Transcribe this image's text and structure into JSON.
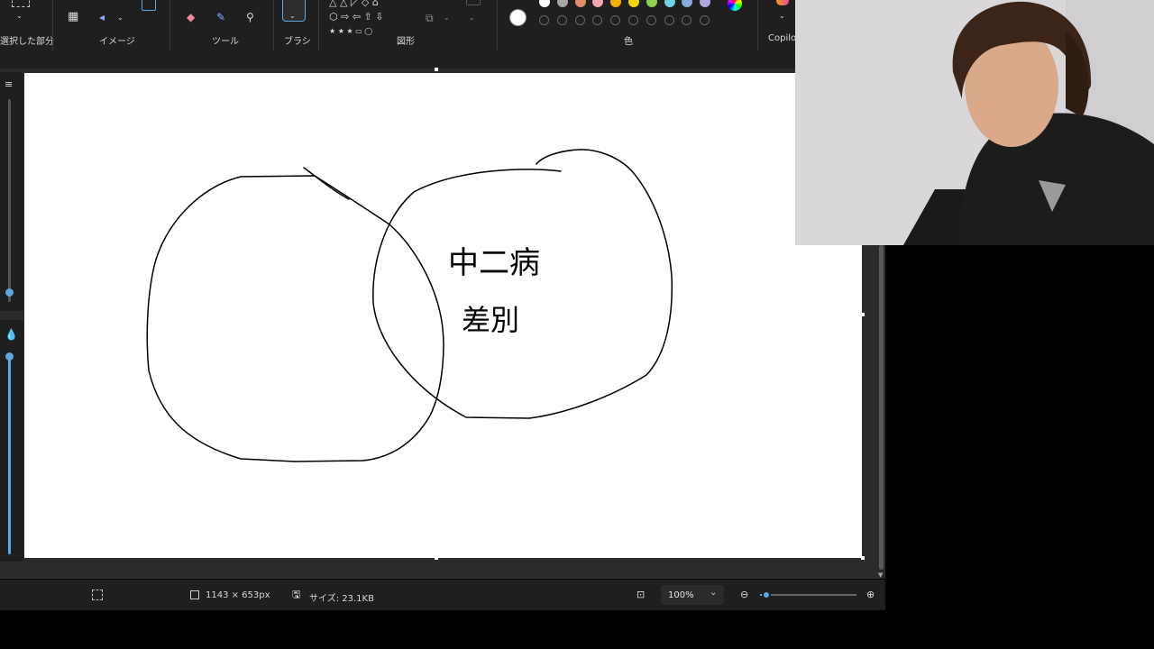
{
  "ribbon": {
    "selection_label": "選択した部分",
    "image_label": "イメージ",
    "tools_label": "ツール",
    "brushes_label": "ブラシ",
    "shapes_label": "図形",
    "colors_label": "色",
    "copilot_label": "Copilot"
  },
  "palette": {
    "row1": [
      "#ffffff",
      "#a6a6a6",
      "#e08c6a",
      "#f4a6b0",
      "#f5b200",
      "#f5d600",
      "#8fd14f",
      "#6fd4e6",
      "#8aa9e0",
      "#b4a7e0"
    ],
    "current_color": "#ffffff"
  },
  "canvas": {
    "handwriting_line1": "中二病",
    "handwriting_line2": "差別"
  },
  "status": {
    "dimensions": "1143 × 653px",
    "size": "サイズ: 23.1KB",
    "zoom": "100%",
    "zoom_level": 0.07
  }
}
